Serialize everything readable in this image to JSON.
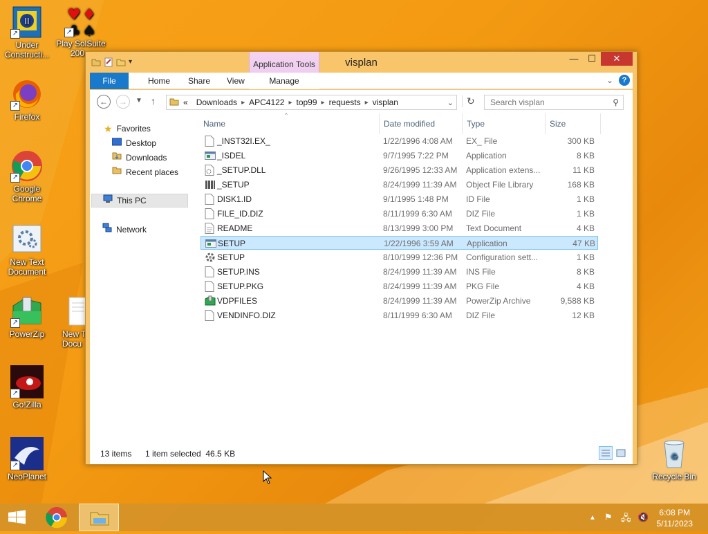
{
  "desktop": {
    "icons": [
      {
        "label": "Under Constructi..."
      },
      {
        "label": "Play SolSuite 200..."
      },
      {
        "label": "Firefox"
      },
      {
        "label": "Google Chrome"
      },
      {
        "label": "New Text Document"
      },
      {
        "label": "PowerZip"
      },
      {
        "label": "New T Docu"
      },
      {
        "label": "Go!Zilla"
      },
      {
        "label": "NeoPlanet"
      },
      {
        "label": "Recycle Bin"
      }
    ]
  },
  "window": {
    "title": "visplan",
    "context_tab": "Application Tools",
    "ribbon_tabs": [
      "File",
      "Home",
      "Share",
      "View",
      "Manage"
    ],
    "address": {
      "prefix": "«",
      "crumbs": [
        "Downloads",
        "APC4122",
        "top99",
        "requests",
        "visplan"
      ]
    },
    "search": {
      "placeholder": "Search visplan"
    },
    "sidebar": {
      "favorites": "Favorites",
      "desktop": "Desktop",
      "downloads": "Downloads",
      "recent": "Recent places",
      "this_pc": "This PC",
      "network": "Network"
    },
    "columns": {
      "name": "Name",
      "date": "Date modified",
      "type": "Type",
      "size": "Size"
    },
    "files": [
      {
        "name": "_INST32I.EX_",
        "date": "1/22/1996 4:08 AM",
        "type": "EX_ File",
        "size": "300 KB",
        "icon": "file-icon"
      },
      {
        "name": "_ISDEL",
        "date": "9/7/1995 7:22 PM",
        "type": "Application",
        "size": "8 KB",
        "icon": "application-icon"
      },
      {
        "name": "_SETUP.DLL",
        "date": "9/26/1995 12:33 AM",
        "type": "Application extens...",
        "size": "11 KB",
        "icon": "dll-icon"
      },
      {
        "name": "_SETUP",
        "date": "8/24/1999 11:39 AM",
        "type": "Object File Library",
        "size": "168 KB",
        "icon": "library-icon"
      },
      {
        "name": "DISK1.ID",
        "date": "9/1/1995 1:48 PM",
        "type": "ID File",
        "size": "1 KB",
        "icon": "file-icon"
      },
      {
        "name": "FILE_ID.DIZ",
        "date": "8/11/1999 6:30 AM",
        "type": "DIZ File",
        "size": "1 KB",
        "icon": "file-icon"
      },
      {
        "name": "README",
        "date": "8/13/1999 3:00 PM",
        "type": "Text Document",
        "size": "4 KB",
        "icon": "text-icon"
      },
      {
        "name": "SETUP",
        "date": "1/22/1996 3:59 AM",
        "type": "Application",
        "size": "47 KB",
        "icon": "application-icon",
        "selected": true
      },
      {
        "name": "SETUP",
        "date": "8/10/1999 12:36 PM",
        "type": "Configuration sett...",
        "size": "1 KB",
        "icon": "config-icon"
      },
      {
        "name": "SETUP.INS",
        "date": "8/24/1999 11:39 AM",
        "type": "INS File",
        "size": "8 KB",
        "icon": "file-icon"
      },
      {
        "name": "SETUP.PKG",
        "date": "8/24/1999 11:39 AM",
        "type": "PKG File",
        "size": "4 KB",
        "icon": "file-icon"
      },
      {
        "name": "VDPFILES",
        "date": "8/24/1999 11:39 AM",
        "type": "PowerZip Archive",
        "size": "9,588 KB",
        "icon": "zip-icon"
      },
      {
        "name": "VENDINFO.DIZ",
        "date": "8/11/1999 6:30 AM",
        "type": "DIZ File",
        "size": "12 KB",
        "icon": "file-icon"
      }
    ],
    "status": {
      "count": "13 items",
      "selection": "1 item selected  46.5 KB"
    }
  },
  "taskbar": {
    "time": "6:08 PM",
    "date": "5/11/2023"
  }
}
